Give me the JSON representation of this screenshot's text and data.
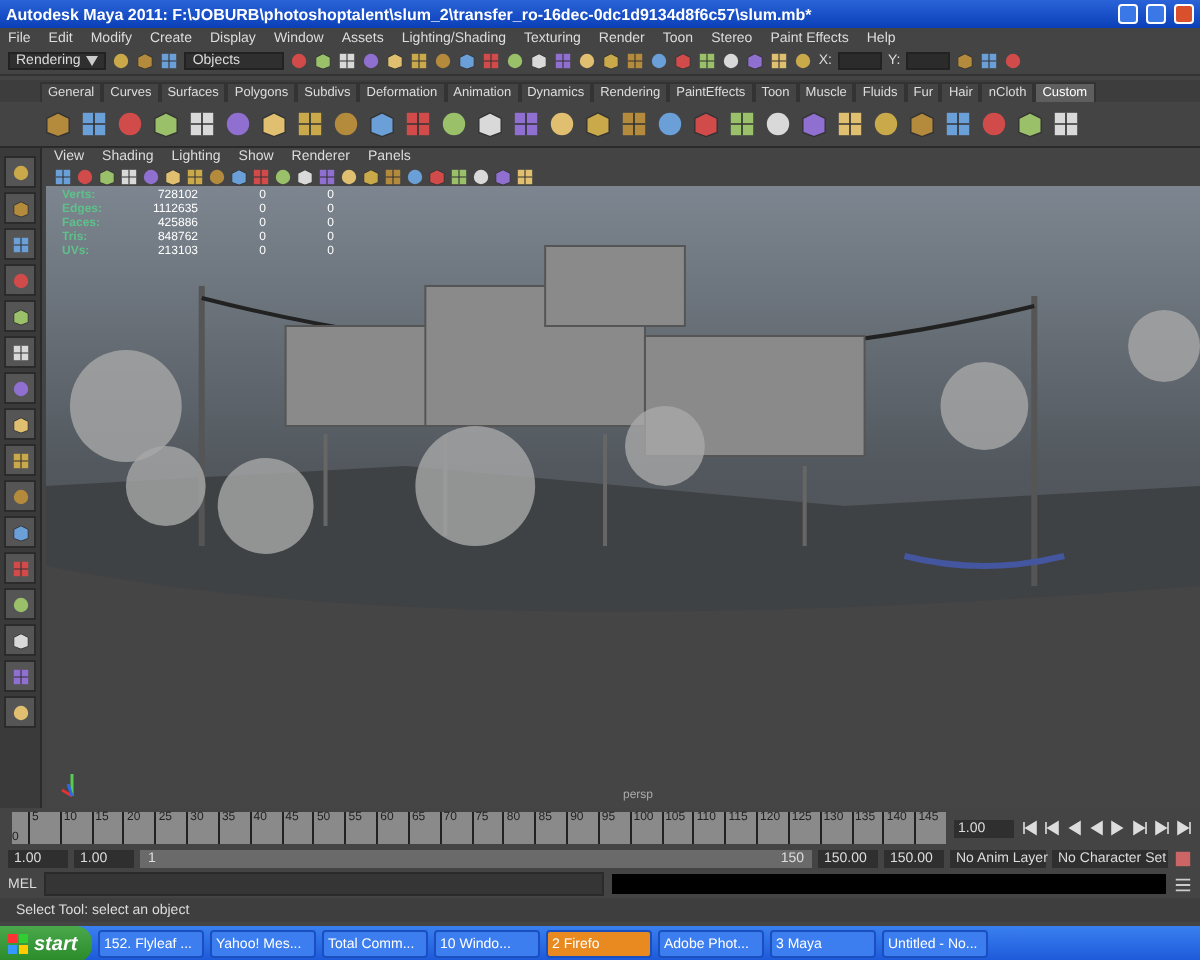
{
  "window": {
    "title": "Autodesk Maya 2011: F:\\JOBURB\\photoshoptalent\\slum_2\\transfer_ro-16dec-0dc1d9134d8f6c57\\slum.mb*"
  },
  "menu": [
    "File",
    "Edit",
    "Modify",
    "Create",
    "Display",
    "Window",
    "Assets",
    "Lighting/Shading",
    "Texturing",
    "Render",
    "Toon",
    "Stereo",
    "Paint Effects",
    "Help"
  ],
  "status_line": {
    "mode": "Rendering",
    "selection_field": "Objects",
    "x_label": "X:",
    "y_label": "Y:"
  },
  "shelf_tabs": [
    {
      "label": "General",
      "selected": false
    },
    {
      "label": "Curves",
      "selected": false
    },
    {
      "label": "Surfaces",
      "selected": false
    },
    {
      "label": "Polygons",
      "selected": false
    },
    {
      "label": "Subdivs",
      "selected": false
    },
    {
      "label": "Deformation",
      "selected": false
    },
    {
      "label": "Animation",
      "selected": false
    },
    {
      "label": "Dynamics",
      "selected": false
    },
    {
      "label": "Rendering",
      "selected": false
    },
    {
      "label": "PaintEffects",
      "selected": false
    },
    {
      "label": "Toon",
      "selected": false
    },
    {
      "label": "Muscle",
      "selected": false
    },
    {
      "label": "Fluids",
      "selected": false
    },
    {
      "label": "Fur",
      "selected": false
    },
    {
      "label": "Hair",
      "selected": false
    },
    {
      "label": "nCloth",
      "selected": false
    },
    {
      "label": "Custom",
      "selected": true
    }
  ],
  "panel_menu": [
    "View",
    "Shading",
    "Lighting",
    "Show",
    "Renderer",
    "Panels"
  ],
  "hud_stats": [
    {
      "label": "Verts:",
      "total": "728102",
      "selected": "0",
      "components": "0"
    },
    {
      "label": "Edges:",
      "total": "1112635",
      "selected": "0",
      "components": "0"
    },
    {
      "label": "Faces:",
      "total": "425886",
      "selected": "0",
      "components": "0"
    },
    {
      "label": "Tris:",
      "total": "848762",
      "selected": "0",
      "components": "0"
    },
    {
      "label": "UVs:",
      "total": "213103",
      "selected": "0",
      "components": "0"
    }
  ],
  "camera_label": "persp",
  "timeline": {
    "ticks": [
      "5",
      "10",
      "15",
      "20",
      "25",
      "30",
      "35",
      "40",
      "45",
      "50",
      "55",
      "60",
      "65",
      "70",
      "75",
      "80",
      "85",
      "90",
      "95",
      "100",
      "105",
      "110",
      "115",
      "120",
      "125",
      "130",
      "135",
      "140",
      "145"
    ],
    "start_label": "0",
    "current_time": "1.00"
  },
  "range": {
    "start": "1.00",
    "range_start": "1.00",
    "slider_start": "1",
    "slider_end": "150",
    "range_end": "150.00",
    "end": "150.00",
    "anim_layer": "No Anim Layer",
    "character_set": "No Character Set"
  },
  "command_line": {
    "label": "MEL"
  },
  "help_line": "Select Tool: select an object",
  "taskbar": {
    "start": "start",
    "items": [
      {
        "label": "152. Flyleaf ...",
        "selected": false
      },
      {
        "label": "Yahoo! Mes...",
        "selected": false
      },
      {
        "label": "Total Comm...",
        "selected": false
      },
      {
        "label": "10 Windo...",
        "selected": false
      },
      {
        "label": "2 Firefo",
        "selected": true
      },
      {
        "label": "Adobe Phot...",
        "selected": false
      },
      {
        "label": "3 Maya",
        "selected": false
      },
      {
        "label": "Untitled - No...",
        "selected": false
      }
    ]
  }
}
